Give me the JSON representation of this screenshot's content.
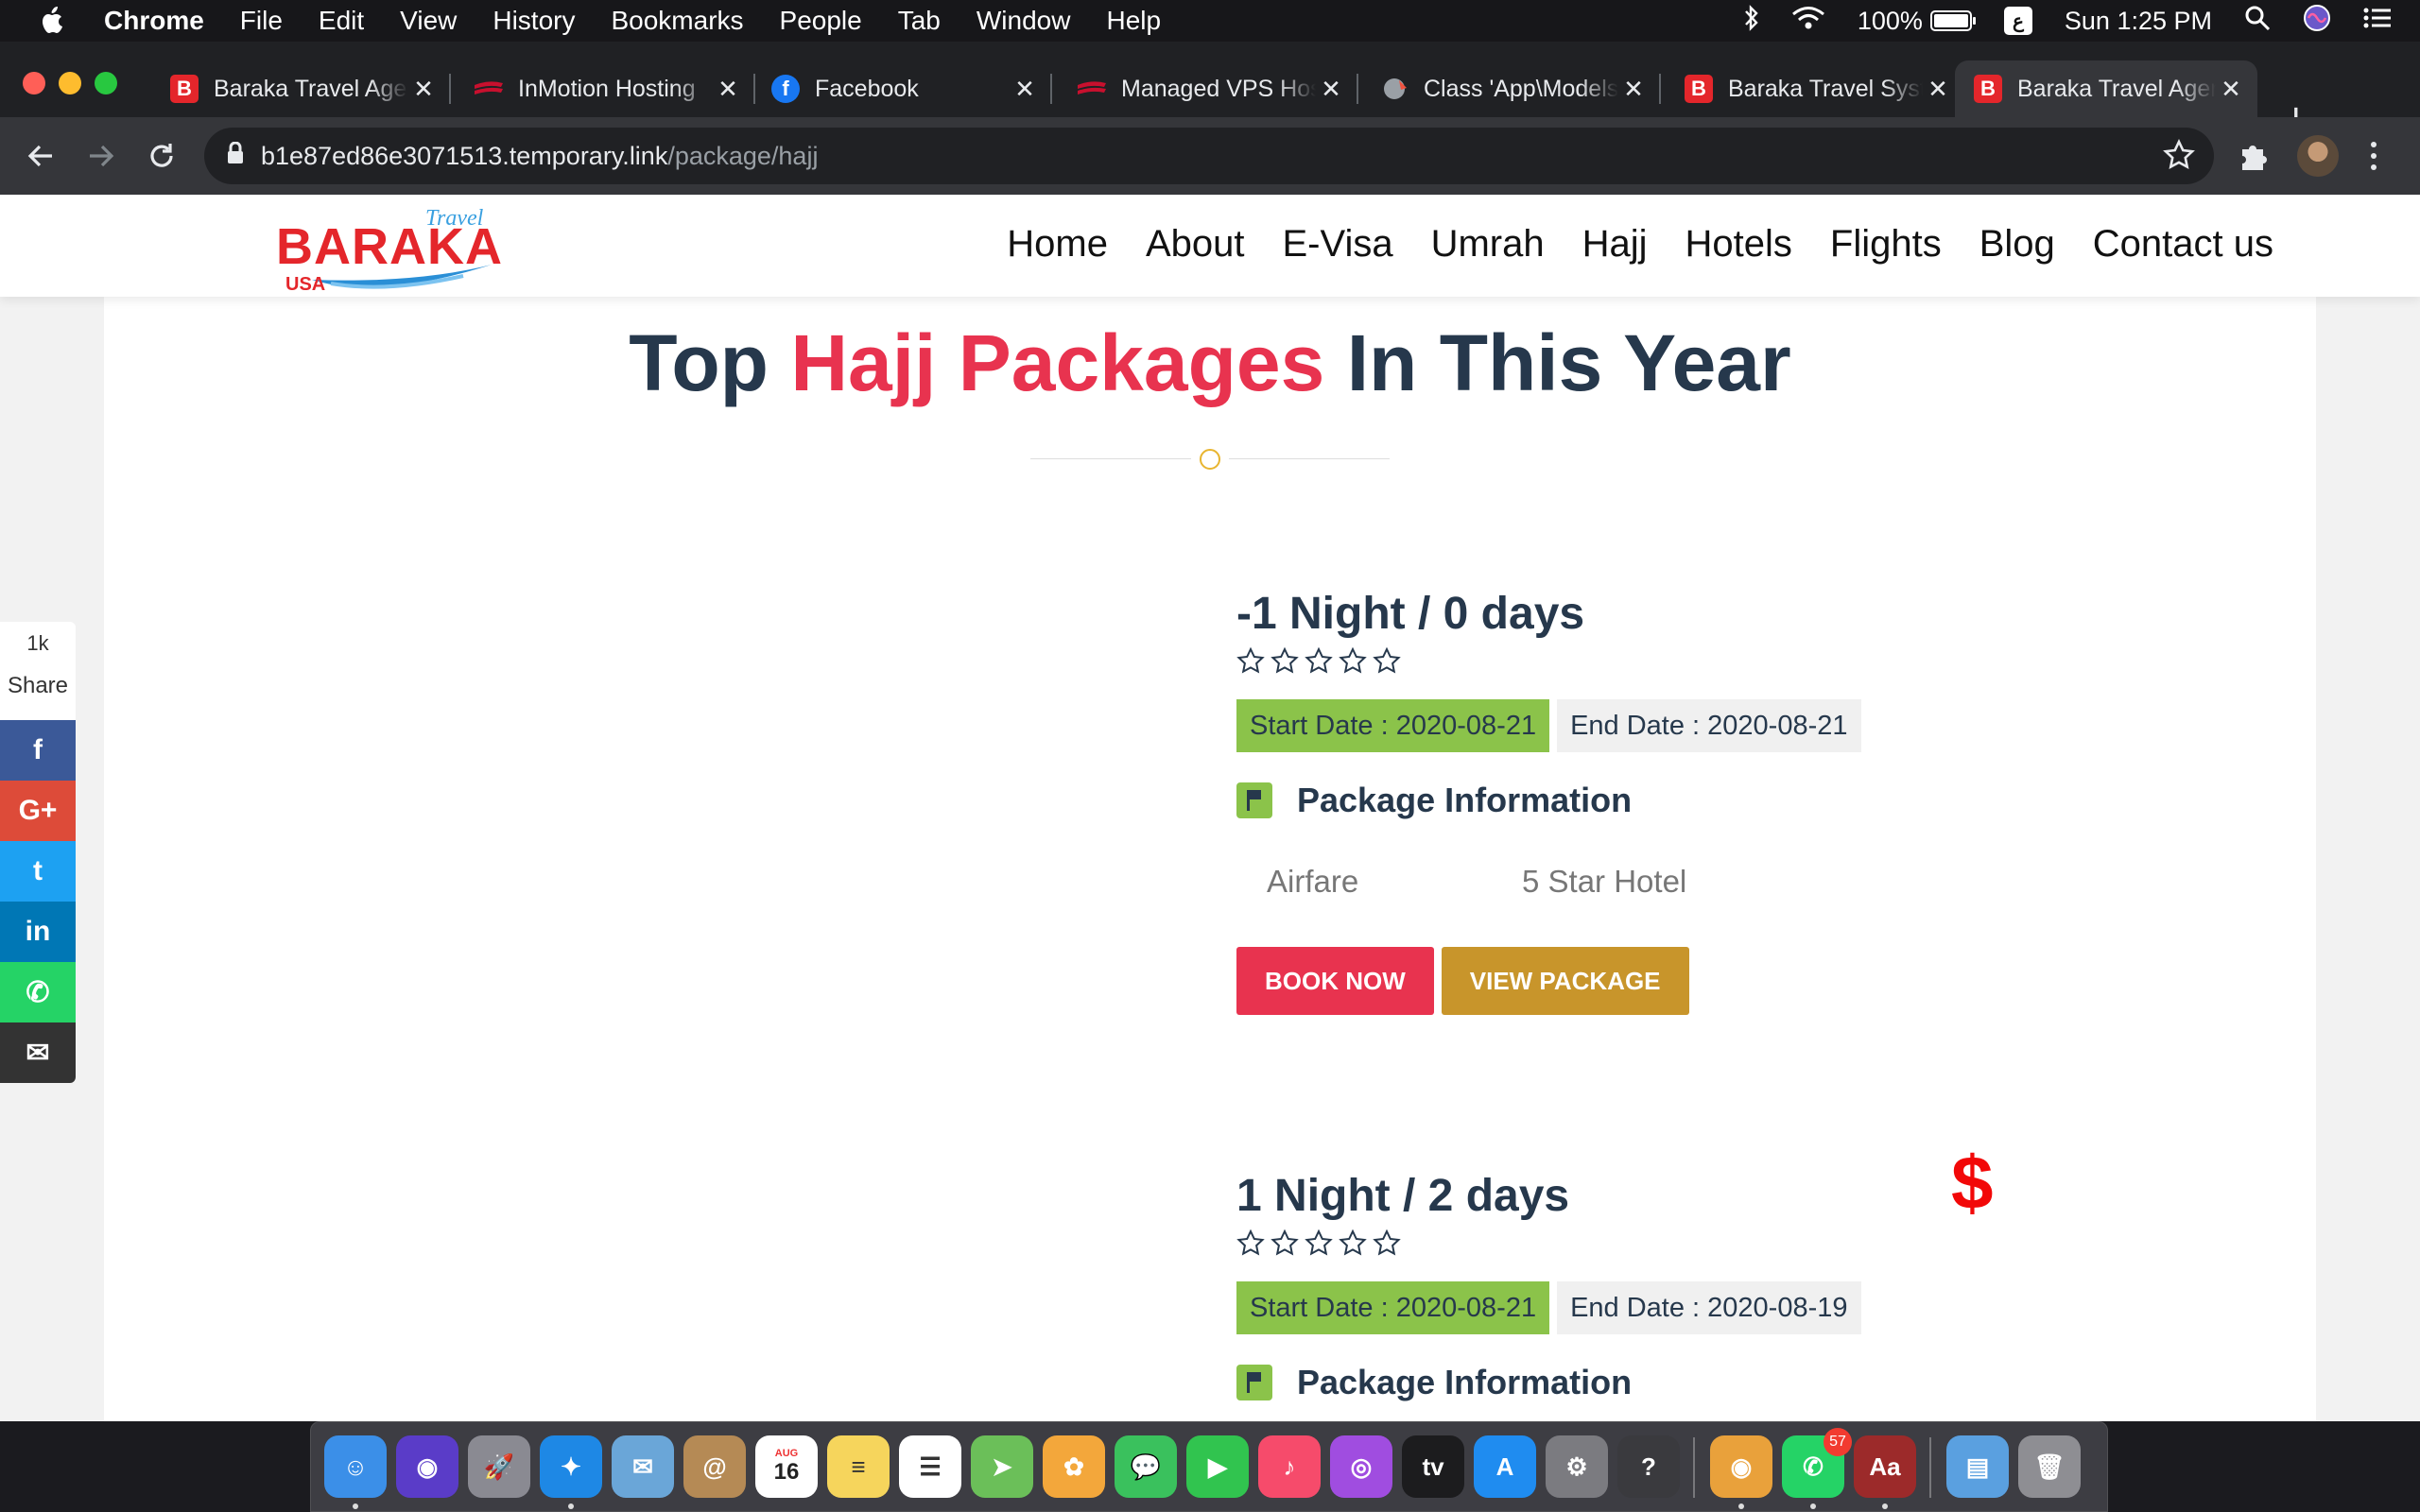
{
  "menubar": {
    "app": "Chrome",
    "items": [
      "File",
      "Edit",
      "View",
      "History",
      "Bookmarks",
      "People",
      "Tab",
      "Window",
      "Help"
    ],
    "battery": "100%",
    "battery_level": 1.0,
    "input_source": "ع",
    "clock": "Sun 1:25 PM"
  },
  "tabs": [
    {
      "title": "Baraka Travel Agency",
      "favicon": "baraka-b",
      "color": "#e4262b"
    },
    {
      "title": "InMotion Hosting",
      "favicon": "inmotion-swoosh",
      "color": "#c8102e"
    },
    {
      "title": "Facebook",
      "favicon": "facebook-f",
      "color": "#1877f2"
    },
    {
      "title": "Managed VPS Hosting",
      "favicon": "inmotion-swoosh",
      "color": "#c8102e"
    },
    {
      "title": "Class 'App\\Models'",
      "favicon": "laravel-globe",
      "color": "#f05340"
    },
    {
      "title": "Baraka Travel System",
      "favicon": "baraka-b",
      "color": "#e4262b"
    },
    {
      "title": "Baraka Travel Agency",
      "favicon": "baraka-b",
      "color": "#e4262b",
      "active": true
    }
  ],
  "address": {
    "host": "b1e87ed86e3071513.temporary.link",
    "path": "/package/hajj"
  },
  "site": {
    "logo": {
      "brand": "BARAKA",
      "travel": "Travel",
      "usa": "USA"
    },
    "nav": [
      "Home",
      "About",
      "E-Visa",
      "Umrah",
      "Hajj",
      "Hotels",
      "Flights",
      "Blog",
      "Contact us"
    ],
    "section_title": {
      "pre": "Top",
      "highlight": "Hajj Packages",
      "post": "In This Year"
    },
    "share": {
      "count": "1k",
      "label": "Share"
    },
    "packages": [
      {
        "title": "-1 Night / 0 days",
        "rating": 0,
        "start": "Start Date : 2020-08-21",
        "end": "End Date : 2020-08-21",
        "info_label": "Package Information",
        "features": [
          "Airfare",
          "5 Star Hotel"
        ],
        "book": "BOOK NOW",
        "view": "VIEW PACKAGE",
        "price": "$"
      },
      {
        "title": "1 Night / 2 days",
        "rating": 0,
        "start": "Start Date : 2020-08-21",
        "end": "End Date : 2020-08-19",
        "info_label": "Package Information"
      }
    ]
  },
  "colors": {
    "accent_red": "#e8334f",
    "navy": "#26384c",
    "green": "#8bc34a",
    "gold": "#c8952b",
    "price_red": "#f20808"
  },
  "share_buttons": [
    {
      "name": "facebook",
      "glyph": "f",
      "color": "#3b5998"
    },
    {
      "name": "google-plus",
      "glyph": "G+",
      "color": "#dd4b39"
    },
    {
      "name": "twitter",
      "glyph": "t",
      "color": "#1da1f2"
    },
    {
      "name": "linkedin",
      "glyph": "in",
      "color": "#0077b5"
    },
    {
      "name": "whatsapp",
      "glyph": "✆",
      "color": "#25d366"
    },
    {
      "name": "email",
      "glyph": "✉",
      "color": "#333333"
    }
  ],
  "dock": [
    {
      "name": "finder",
      "color": "#3b8fe8",
      "glyph": "☺",
      "running": true
    },
    {
      "name": "siri",
      "color": "#5a3cc8",
      "glyph": "◉"
    },
    {
      "name": "launchpad",
      "color": "#8a8a92",
      "glyph": "🚀"
    },
    {
      "name": "safari",
      "color": "#1e88e5",
      "glyph": "✦",
      "running": true
    },
    {
      "name": "mail-bird",
      "color": "#6aa6d8",
      "glyph": "✉"
    },
    {
      "name": "contacts",
      "color": "#b58a55",
      "glyph": "@"
    },
    {
      "name": "calendar",
      "color": "#ffffff",
      "glyph": "16",
      "label_month": "AUG"
    },
    {
      "name": "notes",
      "color": "#f6d55c",
      "glyph": "≡"
    },
    {
      "name": "reminders",
      "color": "#ffffff",
      "glyph": "☰"
    },
    {
      "name": "maps",
      "color": "#6bbf59",
      "glyph": "➤"
    },
    {
      "name": "photos",
      "color": "#f3a73b",
      "glyph": "✿"
    },
    {
      "name": "messages",
      "color": "#3ac15d",
      "glyph": "💬"
    },
    {
      "name": "facetime",
      "color": "#31c44f",
      "glyph": "▶"
    },
    {
      "name": "music",
      "color": "#f64b6b",
      "glyph": "♪"
    },
    {
      "name": "podcasts",
      "color": "#a04de0",
      "glyph": "◎"
    },
    {
      "name": "apple-tv",
      "color": "#1c1c1e",
      "glyph": "tv"
    },
    {
      "name": "app-store",
      "color": "#1f8cf0",
      "glyph": "A"
    },
    {
      "name": "system-preferences",
      "color": "#7b7b80",
      "glyph": "⚙"
    },
    {
      "name": "help",
      "color": "#3a3a3e",
      "glyph": "?"
    },
    {
      "name": "chrome",
      "color": "#e9a13b",
      "glyph": "◉",
      "running": true
    },
    {
      "name": "whatsapp",
      "color": "#25d366",
      "glyph": "✆",
      "badge": "57",
      "running": true
    },
    {
      "name": "dictionary",
      "color": "#9c2a2a",
      "glyph": "Aa",
      "running": true
    },
    {
      "name": "downloads-folder",
      "color": "#5aa0e0",
      "glyph": "▤"
    },
    {
      "name": "trash",
      "color": "#8e8e93",
      "glyph": "🗑"
    }
  ]
}
